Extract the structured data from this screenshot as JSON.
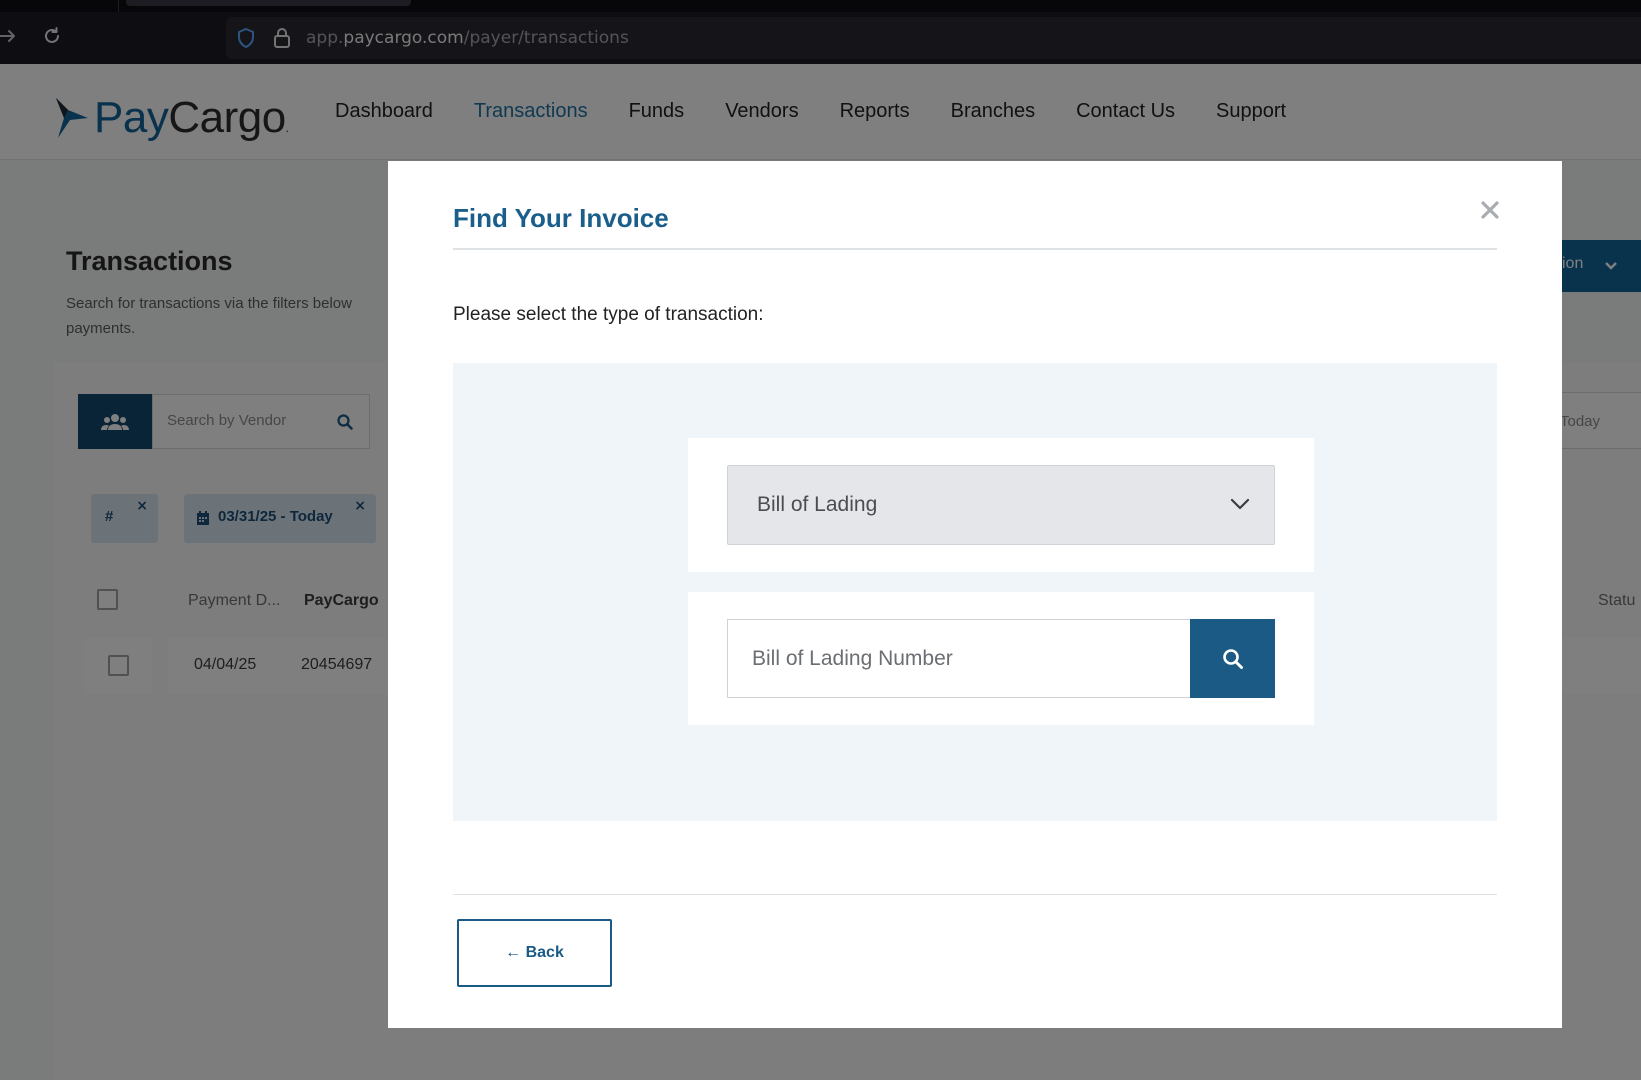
{
  "browser": {
    "url_prefix": "app.",
    "url_host": "paycargo.com",
    "url_path": "/payer/transactions"
  },
  "brand": {
    "logo_pay": "Pay",
    "logo_cargo": "Cargo",
    "logo_mark": ".",
    "primary_color": "#12649a",
    "dark_color": "#1a5a85"
  },
  "nav": {
    "dashboard": "Dashboard",
    "transactions": "Transactions",
    "funds": "Funds",
    "vendors": "Vendors",
    "reports": "Reports",
    "branches": "Branches",
    "contact": "Contact Us",
    "support": "Support"
  },
  "page": {
    "title": "Transactions",
    "subtitle": "Search for transactions via the filters below payments.",
    "action_label": "ion",
    "vendor_search_placeholder": "Search by Vendor",
    "date_right": "Today",
    "chip_hash": "#",
    "chip_date": "03/31/25 - Today",
    "chip_close": "×",
    "table_headers": {
      "payment_date": "Payment D...",
      "paycargo": "PayCargo",
      "status": "Statu"
    },
    "rows": [
      {
        "payment_date": "04/04/25",
        "paycargo_id": "20454697"
      }
    ]
  },
  "modal": {
    "title": "Find Your Invoice",
    "prompt": "Please select the type of transaction:",
    "select_value": "Bill of Lading",
    "input_placeholder": "Bill of Lading Number",
    "back_label": "← Back"
  }
}
